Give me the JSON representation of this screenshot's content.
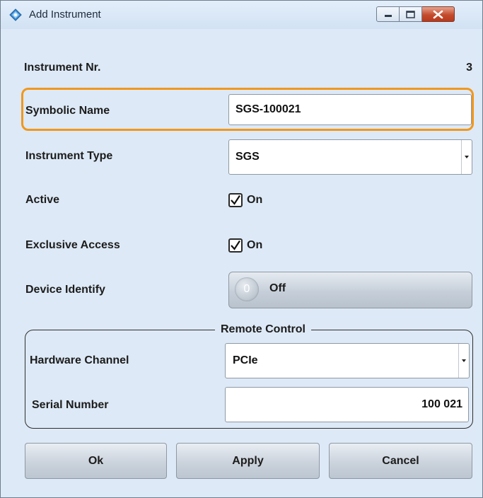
{
  "window": {
    "title": "Add Instrument",
    "icon": "rs-diamond-icon",
    "controls": [
      "minimize-icon",
      "maximize-icon",
      "close-icon"
    ]
  },
  "form": {
    "instrument_nr": {
      "label": "Instrument Nr.",
      "value": "3"
    },
    "symbolic_name": {
      "label": "Symbolic Name",
      "value": "SGS-100021"
    },
    "instrument_type": {
      "label": "Instrument Type",
      "value": "SGS"
    },
    "active": {
      "label": "Active",
      "checked": true,
      "state_text": "On"
    },
    "exclusive_access": {
      "label": "Exclusive Access",
      "checked": true,
      "state_text": "On"
    },
    "device_identify": {
      "label": "Device Identify",
      "knob_text": "0",
      "state_text": "Off"
    }
  },
  "remote_control": {
    "title": "Remote Control",
    "hardware_channel": {
      "label": "Hardware Channel",
      "value": "PCIe"
    },
    "serial_number": {
      "label": "Serial Number",
      "value": "100 021"
    }
  },
  "buttons": {
    "ok": "Ok",
    "apply": "Apply",
    "cancel": "Cancel"
  },
  "colors": {
    "focus_highlight": "#f0981e",
    "background": "#dde9f6",
    "close_button": "#c44c2e"
  }
}
